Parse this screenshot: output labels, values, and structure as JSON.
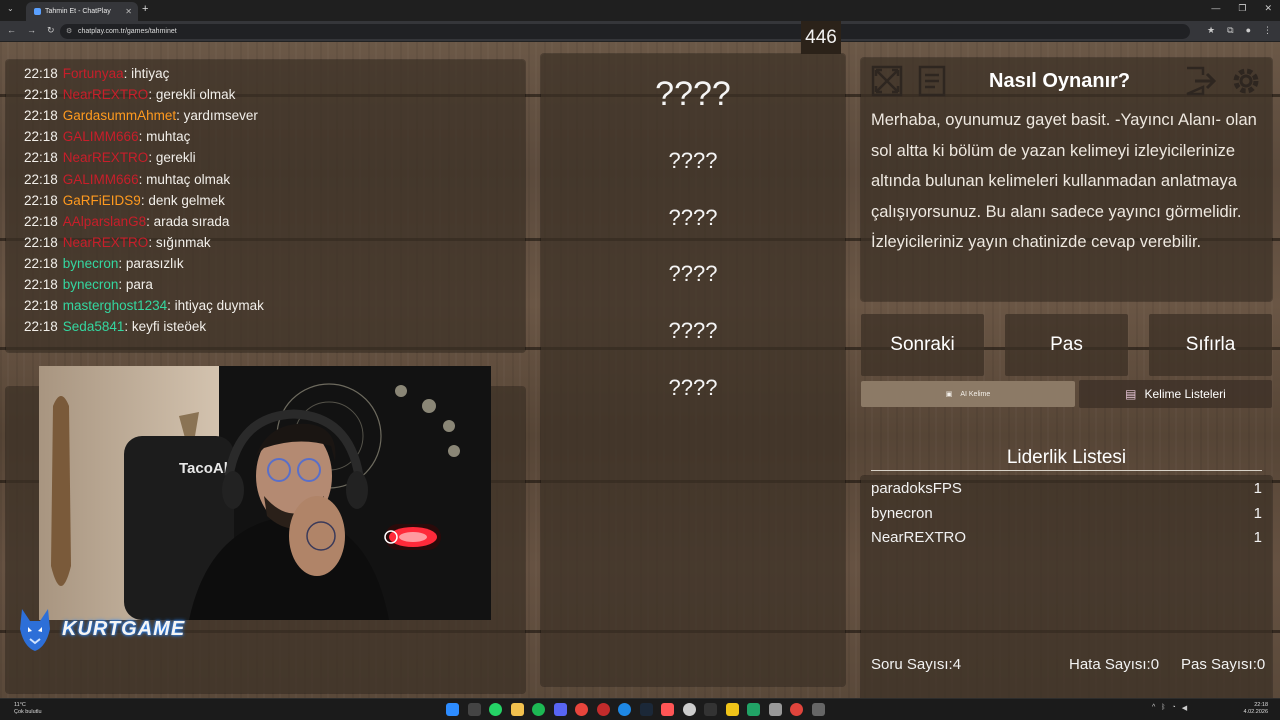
{
  "browser": {
    "tab_title": "Tahmin Et - ChatPlay",
    "url": "chatplay.com.tr/games/tahminet"
  },
  "chat": [
    {
      "time": "22:18",
      "user": "Fortunyaa",
      "color": "#c81e2a",
      "message": "ihtiyaç"
    },
    {
      "time": "22:18",
      "user": "NearREXTRO",
      "color": "#c81e2a",
      "message": "gerekli olmak"
    },
    {
      "time": "22:18",
      "user": "GardasummAhmet",
      "color": "#ff9a1f",
      "message": "yardımsever"
    },
    {
      "time": "22:18",
      "user": "GALIMM666",
      "color": "#c81e2a",
      "message": "muhtaç"
    },
    {
      "time": "22:18",
      "user": "NearREXTRO",
      "color": "#c81e2a",
      "message": "gerekli"
    },
    {
      "time": "22:18",
      "user": "GALIMM666",
      "color": "#c81e2a",
      "message": "muhtaç olmak"
    },
    {
      "time": "22:18",
      "user": "GaRFiEIDS9",
      "color": "#ff9a1f",
      "message": "denk gelmek"
    },
    {
      "time": "22:18",
      "user": "AAlparslanG8",
      "color": "#c81e2a",
      "message": "arada sırada"
    },
    {
      "time": "22:18",
      "user": "NearREXTRO",
      "color": "#c81e2a",
      "message": "sığınmak"
    },
    {
      "time": "22:18",
      "user": "bynecron",
      "color": "#34d7a0",
      "message": "parasızlık"
    },
    {
      "time": "22:18",
      "user": "bynecron",
      "color": "#34d7a0",
      "message": "para"
    },
    {
      "time": "22:18",
      "user": "masterghost1234",
      "color": "#34d7a0",
      "message": "ihtiyaç duymak"
    },
    {
      "time": "22:18",
      "user": "Seda5841",
      "color": "#34d7a0",
      "message": "keyfi isteöek"
    }
  ],
  "webcam": {
    "chair_brand": "TacoAb",
    "logo": "KURTGAME"
  },
  "game": {
    "counter": "446",
    "words": [
      "????",
      "????",
      "????",
      "????",
      "????",
      "????"
    ]
  },
  "info": {
    "title": "Nasıl Oynanır?",
    "text": "Merhaba, oyunumuz gayet basit. -Yayıncı Alanı- olan sol altta ki bölüm de yazan kelimeyi izleyicilerinize altında bulunan kelimeleri kullanmadan anlatmaya çalışıyorsunuz. Bu alanı sadece yayıncı görmelidir. İzleyicileriniz yayın chatinizde cevap verebilir."
  },
  "buttons": {
    "next": "Sonraki",
    "pass": "Pas",
    "reset": "Sıfırla",
    "ai_word": "AI Kelime",
    "word_lists": "Kelime Listeleri"
  },
  "leaderboard": {
    "title": "Liderlik Listesi",
    "rows": [
      {
        "name": "paradoksFPS",
        "score": "1"
      },
      {
        "name": "bynecron",
        "score": "1"
      },
      {
        "name": "NearREXTRO",
        "score": "1"
      }
    ]
  },
  "stats": {
    "questions": "Soru Sayısı:4",
    "errors": "Hata Sayısı:0",
    "passes": "Pas Sayısı:0"
  },
  "taskbar": {
    "temp": "11°C",
    "weather": "Çok bulutlu",
    "time": "22:18",
    "date": "4.02.2026"
  }
}
